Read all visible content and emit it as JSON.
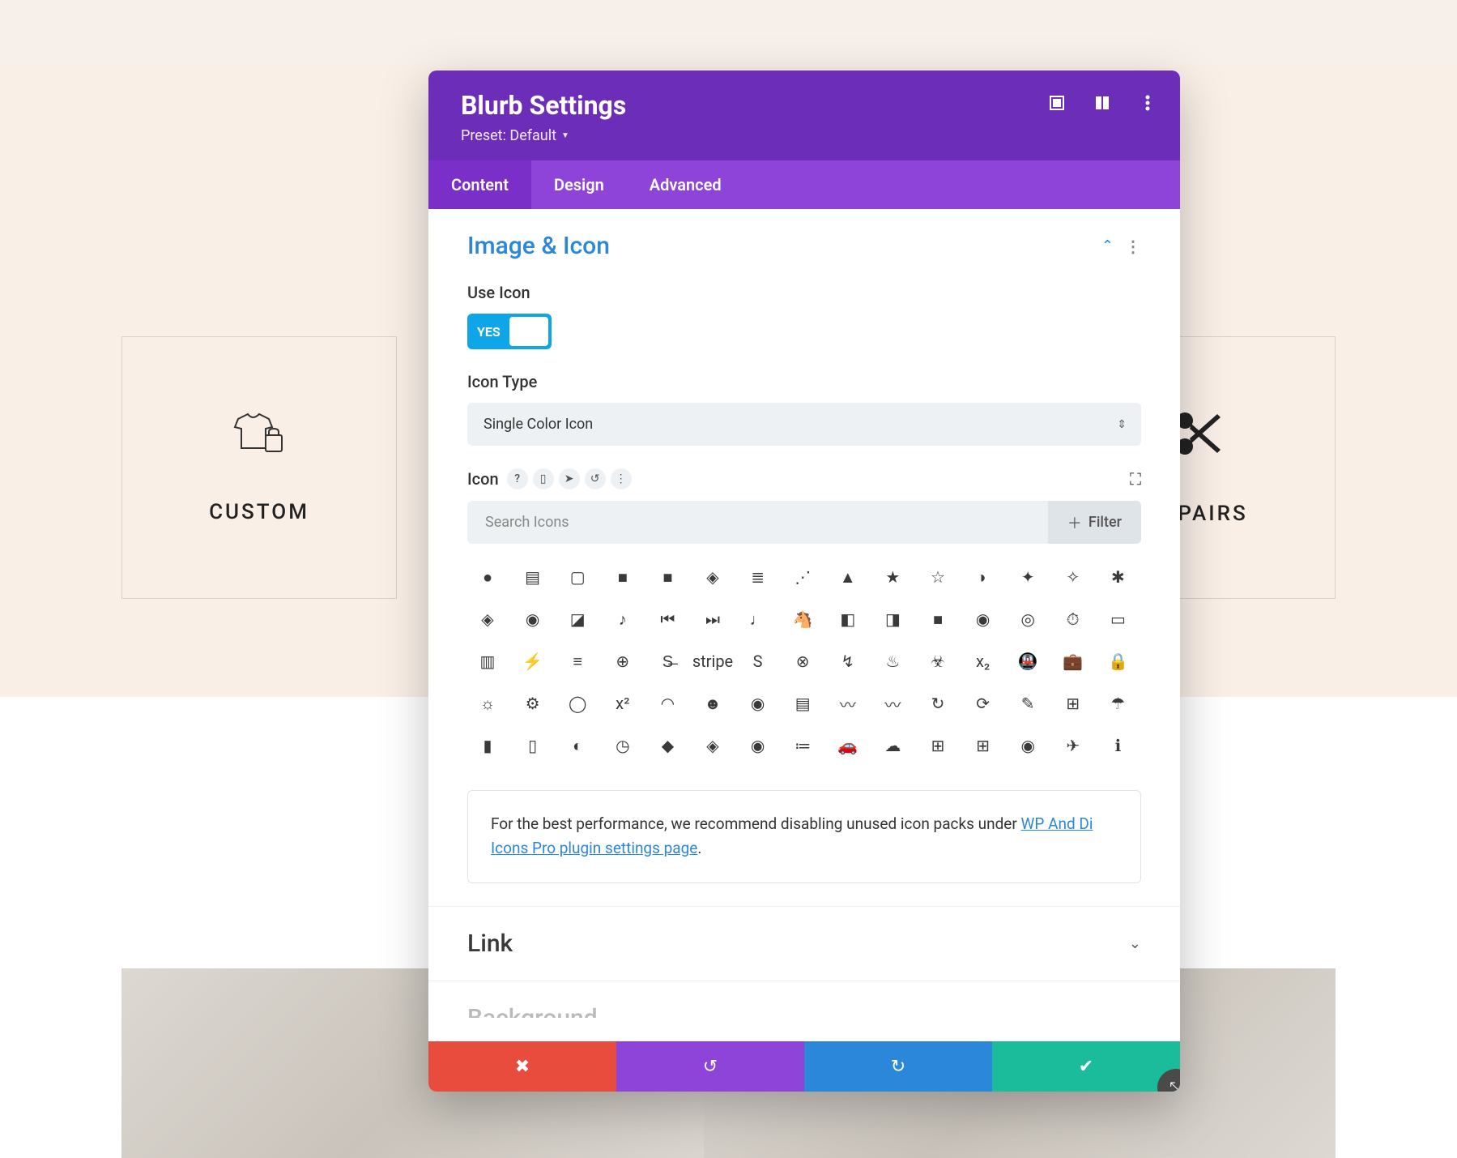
{
  "background": {
    "cards": [
      {
        "label": "CUSTOM",
        "icon_name": "tshirt-bag-icon"
      },
      {
        "label": "REPAIRS",
        "icon_name": "scissors-icon"
      }
    ]
  },
  "modal": {
    "title": "Blurb Settings",
    "preset": "Preset: Default",
    "tabs": [
      {
        "id": "content",
        "label": "Content",
        "active": true
      },
      {
        "id": "design",
        "label": "Design",
        "active": false
      },
      {
        "id": "advanced",
        "label": "Advanced",
        "active": false
      }
    ],
    "sections": {
      "image_icon": {
        "title": "Image & Icon",
        "use_icon_label": "Use Icon",
        "use_icon_value": "YES",
        "icon_type_label": "Icon Type",
        "icon_type_value": "Single Color Icon",
        "icon_label": "Icon",
        "search_placeholder": "Search Icons",
        "filter_label": "Filter",
        "note_prefix": "For the best performance, we recommend disabling unused icon packs under ",
        "note_link": "WP And Di Icons Pro plugin settings page",
        "note_suffix": ".",
        "icon_glyphs": [
          "●",
          "▤",
          "▢",
          "■",
          "■",
          "◈",
          "≣",
          "⋰",
          "▲",
          "★",
          "☆",
          "◗",
          "✦",
          "✧",
          "✱",
          "◈",
          "◉",
          "◪",
          "♪",
          "⏮",
          "⏭",
          "♩",
          "🐴",
          "◧",
          "◨",
          "■",
          "◉",
          "◎",
          "⏱",
          "▭",
          "▥",
          "⚡",
          "≡",
          "⊕",
          "S̶",
          "stripe",
          "S",
          "⊗",
          "↯",
          "♨",
          "☣",
          "x₂",
          "🚇",
          "💼",
          "🔒",
          "☼",
          "⚙",
          "◯",
          "x²",
          "◠",
          "☻",
          "◉",
          "▤",
          "〰",
          "〰",
          "↻",
          "⟳",
          "✎",
          "⊞",
          "☂",
          "▮",
          "▯",
          "◐",
          "◷",
          "◆",
          "◈",
          "◉",
          "≔",
          "🚗",
          "☁",
          "⊞",
          "⊞",
          "◉",
          "✈",
          "ℹ"
        ]
      },
      "link": {
        "title": "Link"
      },
      "background": {
        "title": "Background"
      }
    }
  }
}
